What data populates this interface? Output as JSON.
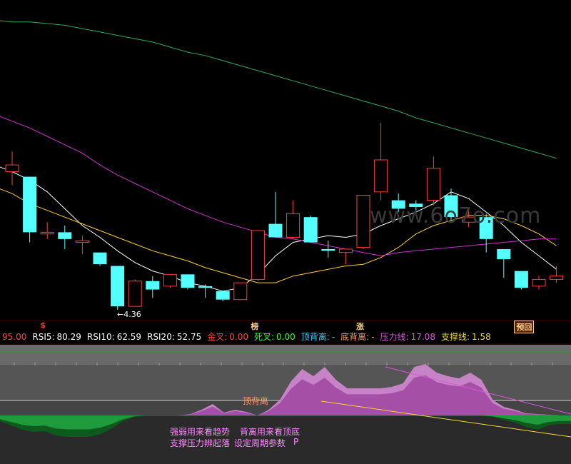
{
  "chart_data": {
    "type": "candlestick",
    "price_panel": {
      "low_annotation": "←4.36",
      "markers": [
        {
          "text": "$",
          "color": "#ff3333",
          "x_index": 2
        },
        {
          "text": "榜",
          "color": "#ffcc88",
          "x_index": 14
        },
        {
          "text": "涨",
          "color": "#ffcc88",
          "x_index": 20
        },
        {
          "text": "预回",
          "color": "#ffcc88",
          "x_index": 29,
          "boxed": true
        }
      ],
      "candles": [
        {
          "o": 5.18,
          "c": 5.22,
          "h": 5.3,
          "l": 5.1,
          "dir": "up"
        },
        {
          "o": 5.15,
          "c": 4.82,
          "h": 5.15,
          "l": 4.76,
          "dir": "down"
        },
        {
          "o": 4.81,
          "c": 4.82,
          "h": 4.88,
          "l": 4.78,
          "dir": "up"
        },
        {
          "o": 4.82,
          "c": 4.78,
          "h": 4.86,
          "l": 4.72,
          "dir": "down"
        },
        {
          "o": 4.76,
          "c": 4.77,
          "h": 4.8,
          "l": 4.69,
          "dir": "up"
        },
        {
          "o": 4.7,
          "c": 4.63,
          "h": 4.7,
          "l": 4.62,
          "dir": "down"
        },
        {
          "o": 4.62,
          "c": 4.38,
          "h": 4.62,
          "l": 4.36,
          "dir": "down"
        },
        {
          "o": 4.38,
          "c": 4.53,
          "h": 4.54,
          "l": 4.38,
          "dir": "up"
        },
        {
          "o": 4.53,
          "c": 4.48,
          "h": 4.56,
          "l": 4.43,
          "dir": "down"
        },
        {
          "o": 4.5,
          "c": 4.57,
          "h": 4.57,
          "l": 4.49,
          "dir": "up"
        },
        {
          "o": 4.57,
          "c": 4.49,
          "h": 4.57,
          "l": 4.48,
          "dir": "down"
        },
        {
          "o": 4.5,
          "c": 4.49,
          "h": 4.51,
          "l": 4.43,
          "dir": "down"
        },
        {
          "o": 4.47,
          "c": 4.42,
          "h": 4.47,
          "l": 4.41,
          "dir": "down"
        },
        {
          "o": 4.42,
          "c": 4.52,
          "h": 4.52,
          "l": 4.42,
          "dir": "up"
        },
        {
          "o": 4.54,
          "c": 4.83,
          "h": 4.83,
          "l": 4.53,
          "dir": "up"
        },
        {
          "o": 4.87,
          "c": 4.79,
          "h": 5.06,
          "l": 4.79,
          "dir": "down"
        },
        {
          "o": 4.79,
          "c": 4.93,
          "h": 5.01,
          "l": 4.78,
          "dir": "up"
        },
        {
          "o": 4.91,
          "c": 4.76,
          "h": 4.92,
          "l": 4.76,
          "dir": "down"
        },
        {
          "o": 4.72,
          "c": 4.71,
          "h": 4.77,
          "l": 4.67,
          "dir": "down"
        },
        {
          "o": 4.7,
          "c": 4.72,
          "h": 4.72,
          "l": 4.63,
          "dir": "up"
        },
        {
          "o": 4.73,
          "c": 5.04,
          "h": 5.04,
          "l": 4.72,
          "dir": "up"
        },
        {
          "o": 5.06,
          "c": 5.25,
          "h": 5.47,
          "l": 5.01,
          "dir": "up"
        },
        {
          "o": 5.01,
          "c": 4.96,
          "h": 5.05,
          "l": 4.94,
          "dir": "down"
        },
        {
          "o": 4.99,
          "c": 4.97,
          "h": 5.01,
          "l": 4.95,
          "dir": "down"
        },
        {
          "o": 5.01,
          "c": 5.2,
          "h": 5.27,
          "l": 4.98,
          "dir": "up"
        },
        {
          "o": 5.04,
          "c": 4.91,
          "h": 5.08,
          "l": 4.89,
          "dir": "down"
        },
        {
          "o": 4.88,
          "c": 4.91,
          "h": 4.96,
          "l": 4.85,
          "dir": "up"
        },
        {
          "o": 4.91,
          "c": 4.78,
          "h": 4.93,
          "l": 4.7,
          "dir": "down"
        },
        {
          "o": 4.72,
          "c": 4.66,
          "h": 4.72,
          "l": 4.55,
          "dir": "down"
        },
        {
          "o": 4.59,
          "c": 4.49,
          "h": 4.59,
          "l": 4.48,
          "dir": "down"
        },
        {
          "o": 4.5,
          "c": 4.54,
          "h": 4.56,
          "l": 4.48,
          "dir": "up"
        },
        {
          "o": 4.54,
          "c": 4.56,
          "h": 4.62,
          "l": 4.52,
          "dir": "up"
        }
      ],
      "ma_lines": [
        {
          "color": "#ffffff",
          "values": [
            5.22,
            5.18,
            5.13,
            5.06,
            4.96,
            4.86,
            4.79,
            4.71,
            4.64,
            4.59,
            4.56,
            4.52,
            4.5,
            4.47,
            4.49,
            4.57,
            4.68,
            4.76,
            4.78,
            4.8,
            4.79,
            4.81,
            4.86,
            4.9,
            4.94,
            4.99,
            5.06,
            5.02,
            4.94,
            4.86,
            4.76,
            4.68,
            4.6
          ]
        },
        {
          "color": "#ffcc33",
          "values": [
            5.09,
            5.05,
            4.99,
            4.95,
            4.91,
            4.87,
            4.83,
            4.79,
            4.75,
            4.71,
            4.68,
            4.65,
            4.61,
            4.58,
            4.55,
            4.52,
            4.52,
            4.56,
            4.58,
            4.6,
            4.62,
            4.63,
            4.67,
            4.73,
            4.81,
            4.86,
            4.89,
            4.92,
            4.92,
            4.9,
            4.86,
            4.81,
            4.74
          ]
        },
        {
          "color": "#cc33cc",
          "values": [
            5.52,
            5.48,
            5.44,
            5.39,
            5.34,
            5.29,
            5.22,
            5.16,
            5.11,
            5.06,
            5.01,
            4.96,
            4.92,
            4.88,
            4.85,
            4.82,
            4.79,
            4.78,
            4.76,
            4.74,
            4.72,
            4.7,
            4.68,
            4.7,
            4.71,
            4.72,
            4.73,
            4.74,
            4.75,
            4.76,
            4.77,
            4.78,
            4.78
          ]
        },
        {
          "color": "#33aa55",
          "values": [
            6.08,
            6.07,
            6.07,
            6.06,
            6.05,
            6.03,
            6.01,
            5.99,
            5.97,
            5.95,
            5.92,
            5.89,
            5.87,
            5.84,
            5.81,
            5.78,
            5.75,
            5.72,
            5.69,
            5.66,
            5.63,
            5.6,
            5.57,
            5.54,
            5.5,
            5.47,
            5.44,
            5.41,
            5.38,
            5.35,
            5.32,
            5.29,
            5.26
          ]
        }
      ]
    },
    "indicator_panel": {
      "stats": [
        {
          "key": "",
          "value": "95.00",
          "color": "#ff4444"
        },
        {
          "key": "RSI5:",
          "value": "80.29",
          "color": "#ffffff"
        },
        {
          "key": "RSI10:",
          "value": "62.59",
          "color": "#ffffff"
        },
        {
          "key": "RSI20:",
          "value": "52.75",
          "color": "#ffffff"
        },
        {
          "key": "金叉:",
          "value": "0.00",
          "color": "#ff4444"
        },
        {
          "key": "死叉:",
          "value": "0.00",
          "color": "#33ff33"
        },
        {
          "key": "顶背离:",
          "value": "-",
          "color": "#33ccff"
        },
        {
          "key": "底背离:",
          "value": "-",
          "color": "#ff9966"
        },
        {
          "key": "压力线:",
          "value": "17.08",
          "color": "#dd55dd"
        },
        {
          "key": "支撑线:",
          "value": "1.58",
          "color": "#eedd33"
        }
      ],
      "series_upper": [
        0,
        0,
        0,
        0,
        0,
        0,
        0,
        0,
        0,
        0,
        0,
        0,
        0,
        0,
        0,
        0,
        0,
        2,
        8,
        16,
        4,
        8,
        5,
        0,
        8,
        22,
        48,
        65,
        55,
        68,
        50,
        38,
        38,
        38,
        38,
        40,
        45,
        68,
        72,
        60,
        55,
        52,
        60,
        50,
        22,
        12,
        8,
        3,
        2,
        1,
        0,
        0
      ],
      "series_lower": [
        -8,
        -14,
        -20,
        -23,
        -22,
        -28,
        -30,
        -30,
        -30,
        -26,
        -18,
        -8,
        -2,
        0,
        0,
        0,
        0,
        0,
        0,
        0,
        0,
        0,
        0,
        0,
        0,
        0,
        0,
        0,
        0,
        0,
        0,
        0,
        0,
        0,
        0,
        0,
        0,
        0,
        0,
        0,
        0,
        0,
        0,
        0,
        -2,
        -6,
        -10,
        -16,
        -20,
        -14,
        -12,
        -12
      ],
      "notes": [
        "强弱用来看趋势",
        "背离用来看顶底",
        "支撑压力辨起落",
        "设定周期参数",
        "P"
      ],
      "divergence_label": "顶背离"
    }
  },
  "watermark": "www.6o7o.com"
}
